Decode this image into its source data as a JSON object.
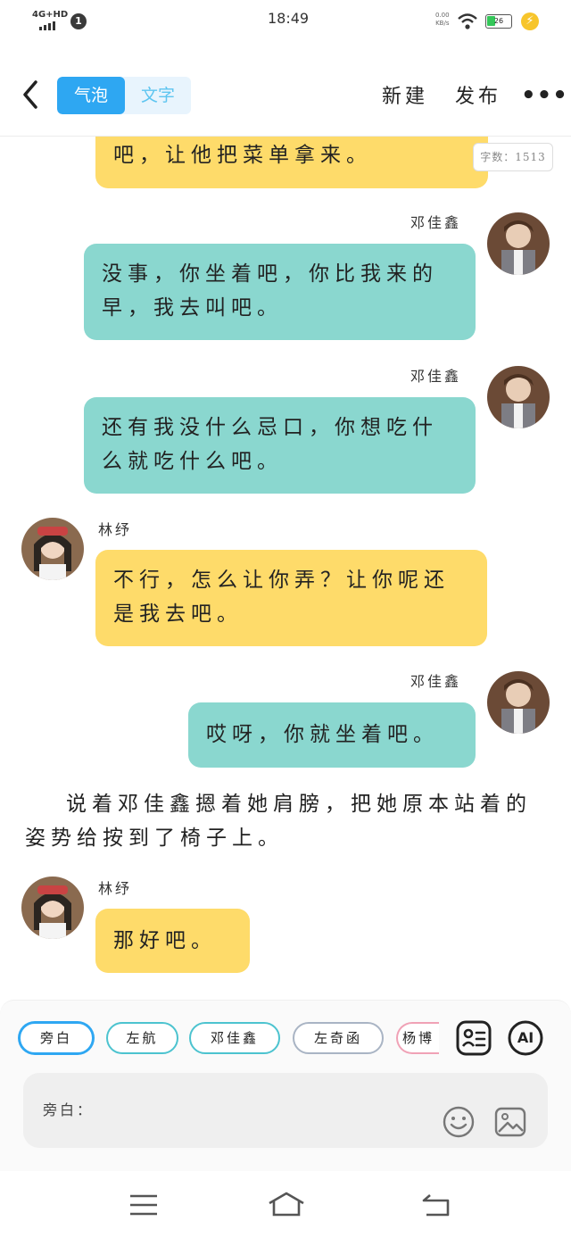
{
  "status_bar": {
    "network": "4G+HD",
    "notification_count": "1",
    "time": "18:49",
    "speed_value": "0.00",
    "speed_unit": "KB/s",
    "battery": "26"
  },
  "header": {
    "tab_bubble": "气泡",
    "tab_text": "文字",
    "new_label": "新建",
    "publish_label": "发布",
    "more_label": "•••"
  },
  "word_count": "字数：1513",
  "messages": [
    {
      "speaker": "",
      "side": "left",
      "text": "吧，让他把菜单拿来。"
    },
    {
      "speaker": "邓佳鑫",
      "side": "right",
      "text": "没事，你坐着吧，你比我来的早，我去叫吧。"
    },
    {
      "speaker": "邓佳鑫",
      "side": "right",
      "text": "还有我没什么忌口，你想吃什么就吃什么吧。"
    },
    {
      "speaker": "林纾",
      "side": "left",
      "text": "不行，怎么让你弄？让你呢还是我去吧。"
    },
    {
      "speaker": "邓佳鑫",
      "side": "right",
      "text": "哎呀，你就坐着吧。"
    },
    {
      "speaker": "林纾",
      "side": "left",
      "text": "那好吧。"
    }
  ],
  "narration": "说着邓佳鑫摁着她肩膀，把她原本站着的姿势给按到了椅子上。",
  "role_chips": [
    {
      "label": "旁白",
      "color": "#2ea7f2"
    },
    {
      "label": "左航",
      "color": "#4cc3cf"
    },
    {
      "label": "邓佳鑫",
      "color": "#4cc3cf"
    },
    {
      "label": "左奇函",
      "color": "#a9b4c4"
    },
    {
      "label": "杨博",
      "color": "#f0a2b6"
    }
  ],
  "ai_label": "AI",
  "input": {
    "label": "旁白："
  },
  "icons": [
    "back-icon",
    "person-card-icon",
    "emoji-icon",
    "image-icon",
    "menu-icon",
    "home-icon",
    "return-icon"
  ]
}
